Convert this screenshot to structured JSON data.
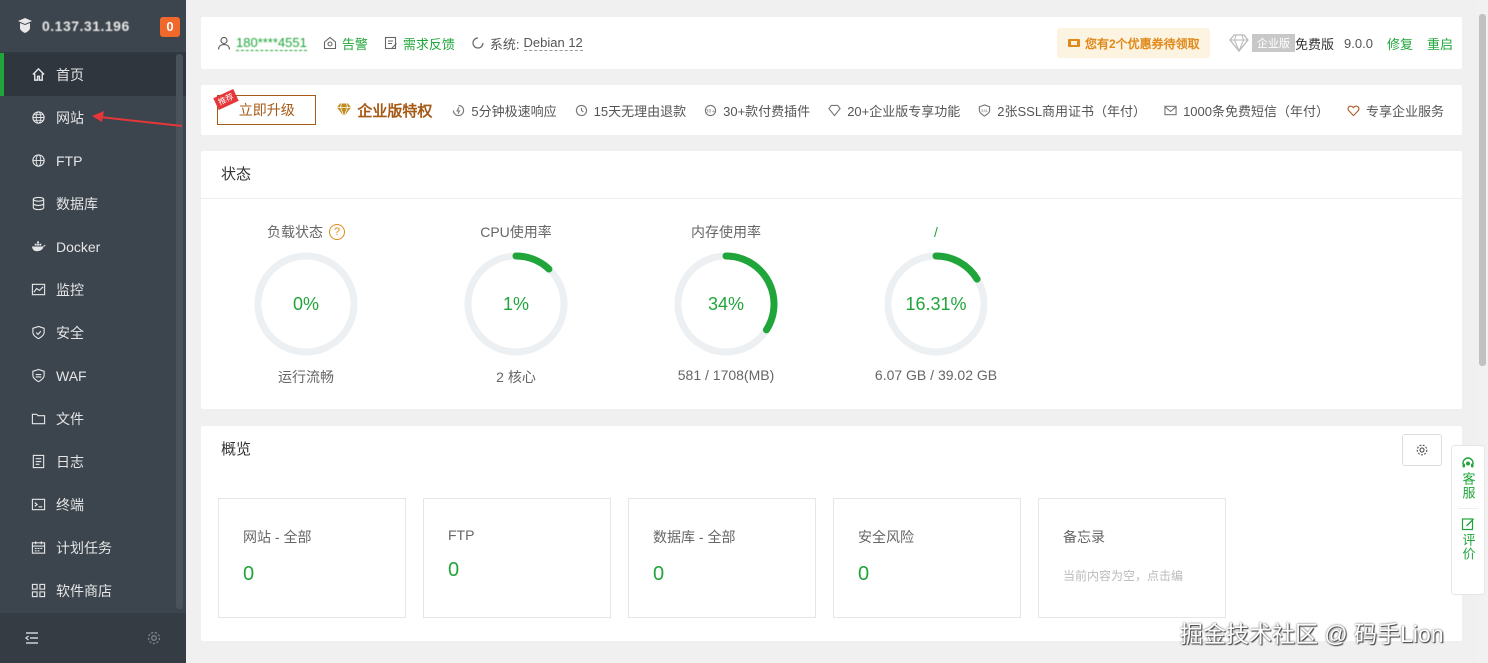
{
  "sidebar": {
    "server_ip": "0.137.31.196",
    "notice_count": "0",
    "items": [
      {
        "label": "首页",
        "icon": "home-icon"
      },
      {
        "label": "网站",
        "icon": "globe-icon"
      },
      {
        "label": "FTP",
        "icon": "globe-icon"
      },
      {
        "label": "数据库",
        "icon": "database-icon"
      },
      {
        "label": "Docker",
        "icon": "docker-icon"
      },
      {
        "label": "监控",
        "icon": "monitor-chart-icon"
      },
      {
        "label": "安全",
        "icon": "shield-icon"
      },
      {
        "label": "WAF",
        "icon": "waf-shield-icon"
      },
      {
        "label": "文件",
        "icon": "folder-icon"
      },
      {
        "label": "日志",
        "icon": "log-icon"
      },
      {
        "label": "终端",
        "icon": "terminal-icon"
      },
      {
        "label": "计划任务",
        "icon": "calendar-icon"
      },
      {
        "label": "软件商店",
        "icon": "apps-grid-icon"
      }
    ]
  },
  "topbar": {
    "username": "180****4551",
    "alert_label": "告警",
    "feedback_label": "需求反馈",
    "system_label": "系统:",
    "system_value": "Debian 12",
    "coupon_text": "您有2个优惠券待领取",
    "enterprise_badge": "企业版",
    "edition": "免费版",
    "version": "9.0.0",
    "repair_label": "修复",
    "restart_label": "重启"
  },
  "promo": {
    "upgrade_label": "立即升级",
    "ribbon": "推荐",
    "enterprise_title": "企业版特权",
    "perks": [
      "5分钟极速响应",
      "15天无理由退款",
      "30+款付费插件",
      "20+企业版专享功能",
      "2张SSL商用证书（年付）",
      "1000条免费短信（年付）",
      "专享企业服务"
    ]
  },
  "status": {
    "title": "状态",
    "gauges": [
      {
        "title": "负载状态",
        "value_text": "0%",
        "percent": 0,
        "sub": "运行流畅",
        "has_help": true
      },
      {
        "title": "CPU使用率",
        "value_text": "1%",
        "percent": 1,
        "sub": "2 核心",
        "has_help": false
      },
      {
        "title": "内存使用率",
        "value_text": "34%",
        "percent": 34,
        "sub": "581 / 1708(MB)",
        "has_help": false
      },
      {
        "title": "/",
        "value_text": "16.31%",
        "percent": 16.31,
        "sub": "6.07 GB / 39.02 GB",
        "has_help": false
      }
    ],
    "help_mark": "?"
  },
  "overview": {
    "title": "概览",
    "boxes": [
      {
        "label": "网站 - 全部",
        "value": "0"
      },
      {
        "label": "FTP",
        "value": "0"
      },
      {
        "label": "数据库 - 全部",
        "value": "0"
      },
      {
        "label": "安全风险",
        "value": "0"
      }
    ],
    "memo": {
      "label": "备忘录",
      "placeholder": "当前内容为空，点击编"
    }
  },
  "float_service": {
    "service_label": "客服",
    "review_label": "评价"
  },
  "watermark": "掘金技术社区 @ 码手Lion",
  "colors": {
    "accent_green": "#20a53a",
    "sidebar_bg": "#3c444d",
    "gold": "#a55a16",
    "orange": "#f0692b",
    "annotation_red": "#e5373a"
  }
}
